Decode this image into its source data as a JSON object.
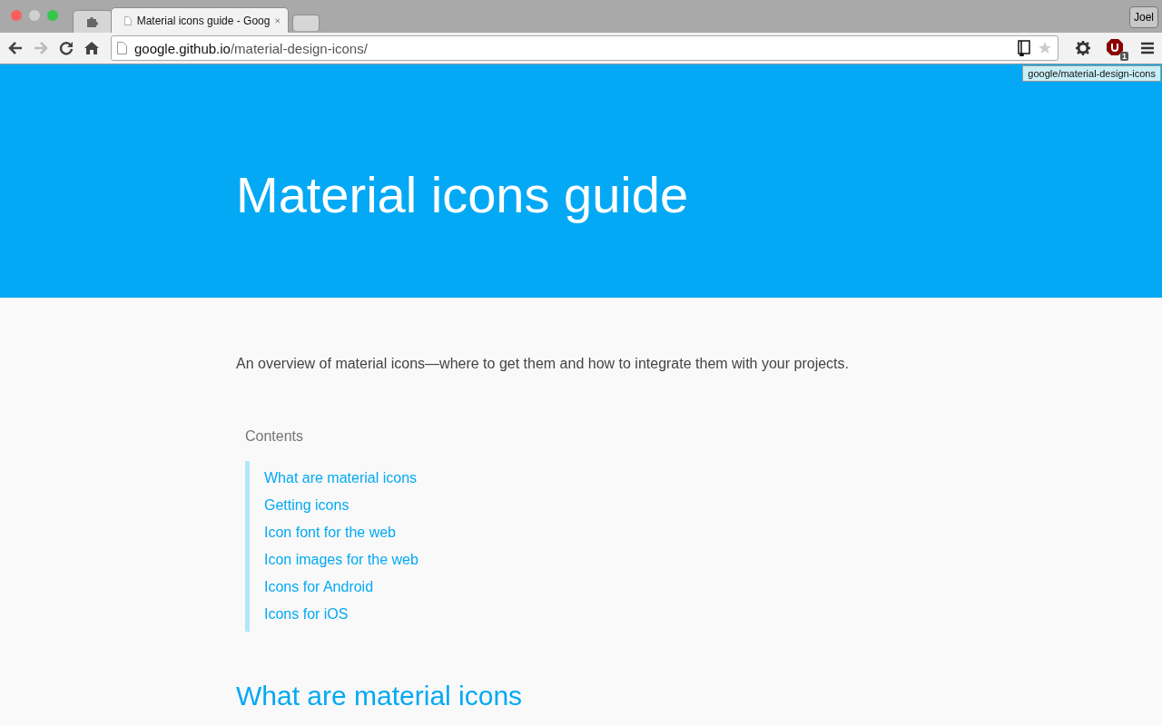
{
  "window": {
    "tabs": [
      {
        "kind": "extension",
        "selected": false
      },
      {
        "kind": "page",
        "title": "Material icons guide - Goog",
        "selected": true
      },
      {
        "kind": "new",
        "selected": false
      }
    ],
    "profile": "Joel"
  },
  "toolbar": {
    "url": {
      "host": "google.github.io",
      "path": "/material-design-icons/"
    },
    "extension_badge": "1",
    "tooltip": "google/material-design-icons"
  },
  "hero": {
    "title": "Material icons guide"
  },
  "intro": "An overview of material icons—where to get them and how to integrate them with your projects.",
  "contents": {
    "heading": "Contents",
    "items": [
      "What are material icons",
      "Getting icons",
      "Icon font for the web",
      "Icon images for the web",
      "Icons for Android",
      "Icons for iOS"
    ]
  },
  "section_heading": "What are material icons"
}
